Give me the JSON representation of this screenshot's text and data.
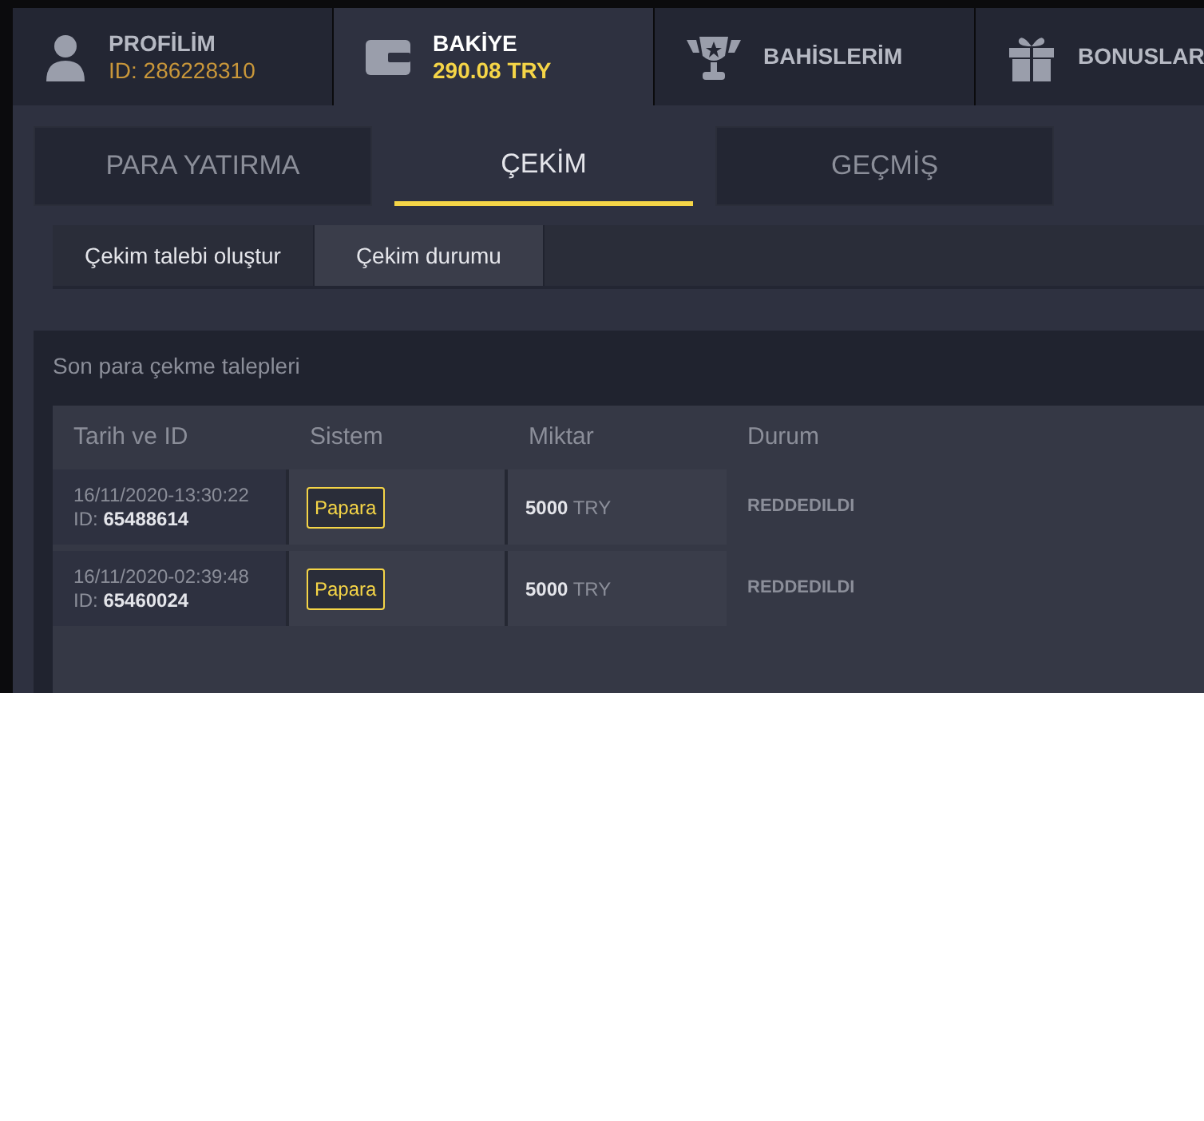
{
  "nav_tabs": [
    {
      "kind": "profile",
      "label": "PROFİLİM",
      "subtitle": "ID: 286228310",
      "selected": false
    },
    {
      "kind": "wallet",
      "label": "BAKİYE",
      "subtitle": "290.08 TRY",
      "selected": true
    },
    {
      "kind": "trophy",
      "label": "BAHİSLERİM",
      "selected": false
    },
    {
      "kind": "gift",
      "label": "BONUSLAR",
      "selected": false
    }
  ],
  "tabs": [
    {
      "label": "PARA YATIRMA",
      "selected": false
    },
    {
      "label": "ÇEKİM",
      "selected": true
    },
    {
      "label": "GEÇMİŞ",
      "selected": false
    }
  ],
  "sub_tabs": [
    {
      "label": "Çekim talebi oluştur",
      "selected": false
    },
    {
      "label": "Çekim durumu",
      "selected": true
    }
  ],
  "section_title": "Son para çekme talepleri",
  "table": {
    "columns": [
      "Tarih ve ID",
      "Sistem",
      "Miktar",
      "Durum"
    ],
    "rows": [
      {
        "date": "16/11/2020-13:30:22",
        "id_label": "ID:",
        "id": "65488614",
        "system": "Papara",
        "amount": "5000",
        "currency": "TRY",
        "status": "REDDEDILDI"
      },
      {
        "date": "16/11/2020-02:39:48",
        "id_label": "ID:",
        "id": "65460024",
        "system": "Papara",
        "amount": "5000",
        "currency": "TRY",
        "status": "REDDEDILDI"
      }
    ]
  }
}
